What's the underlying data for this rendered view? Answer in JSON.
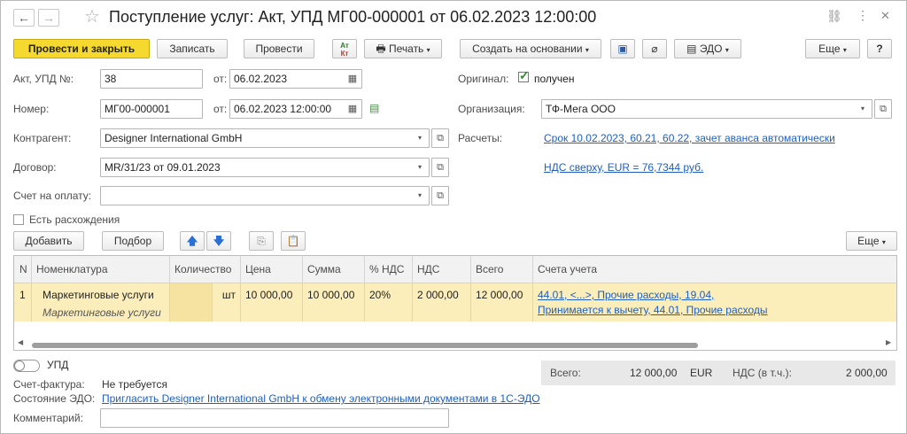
{
  "title": "Поступление услуг: Акт, УПД МГ00-000001 от 06.02.2023 12:00:00",
  "toolbar": {
    "post_close": "Провести и закрыть",
    "save": "Записать",
    "post": "Провести",
    "print": "Печать",
    "create_based": "Создать на основании",
    "edo": "ЭДО",
    "more": "Еще",
    "help": "?"
  },
  "form": {
    "act_label": "Акт, УПД №:",
    "act_value": "38",
    "from_label1": "от:",
    "act_date": "06.02.2023",
    "number_label": "Номер:",
    "number_value": "МГ00-000001",
    "from_label2": "от:",
    "number_date": "06.02.2023 12:00:00",
    "contractor_label": "Контрагент:",
    "contractor_value": "Designer International GmbH",
    "contract_label": "Договор:",
    "contract_value": "MR/31/23 от 09.01.2023",
    "invoice_label": "Счет на оплату:",
    "invoice_value": "",
    "original_label": "Оригинал:",
    "original_value": "получен",
    "org_label": "Организация:",
    "org_value": "ТФ-Мега ООО",
    "settlements_label": "Расчеты:",
    "settlements_link": "Срок 10.02.2023, 60.21, 60.22, зачет аванса автоматически",
    "vat_link": "НДС сверху, EUR = 76,7344 руб.",
    "discrepancy_label": "Есть расхождения"
  },
  "table_toolbar": {
    "add": "Добавить",
    "select": "Подбор",
    "more": "Еще"
  },
  "table": {
    "columns": [
      "N",
      "Номенклатура",
      "Количество",
      "Цена",
      "Сумма",
      "% НДС",
      "НДС",
      "Всего",
      "Счета учета"
    ],
    "rows": [
      {
        "n": "1",
        "item": "Маркетинговые услуги",
        "item_sub": "Маркетинговые услуги",
        "unit": "шт",
        "qty": "",
        "price": "10 000,00",
        "sum": "10 000,00",
        "vat_rate": "20%",
        "vat": "2 000,00",
        "total": "12 000,00",
        "accounts_1": "44.01, <...>, Прочие расходы, 19.04,",
        "accounts_2": "Принимается к вычету, 44.01, Прочие расходы"
      }
    ]
  },
  "footer": {
    "upd_toggle": "УПД",
    "invoice_label": "Счет-фактура:",
    "invoice_value": "Не требуется",
    "edo_label": "Состояние ЭДО:",
    "edo_link": "Пригласить Designer International GmbH к обмену электронными документами в 1С-ЭДО",
    "comment_label": "Комментарий:",
    "comment_value": "",
    "total_label": "Всего:",
    "total_value": "12 000,00",
    "currency": "EUR",
    "vat_label": "НДС (в т.ч.):",
    "vat_value": "2 000,00"
  },
  "colors": {
    "primary": "#f5d92e",
    "row_selected": "#fbeebb",
    "link": "#1f5fbf",
    "check": "#2e8b2e"
  }
}
